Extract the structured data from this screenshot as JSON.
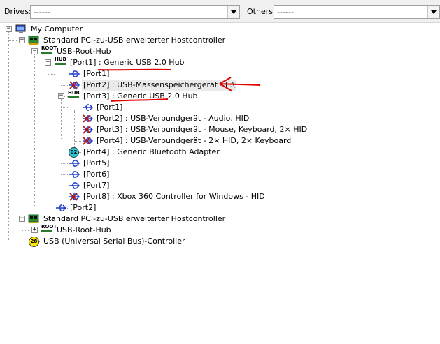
{
  "toolbar": {
    "drives_label": "Drives:",
    "drives_value": "------",
    "others_label": "Others:",
    "others_value": "------"
  },
  "tree": {
    "root": "My Computer",
    "controller1": "Standard PCI-zu-USB erweiterter Hostcontroller",
    "roothub1": "USB-Root-Hub",
    "port1": "[Port1] : Generic USB 2.0 Hub",
    "p1_port1": "[Port1]",
    "p1_port2": "[Port2] : USB-Massenspeichergerät - L:\\",
    "p1_port3": "[Port3] : Generic USB 2.0 Hub",
    "p3_port1": "[Port1]",
    "p3_port2": "[Port2] : USB-Verbundgerät - Audio, HID",
    "p3_port3": "[Port3] : USB-Verbundgerät - Mouse, Keyboard, 2× HID",
    "p3_port4": "[Port4] : USB-Verbundgerät - 2× HID, 2× Keyboard",
    "p1_port4": "[Port4] : Generic Bluetooth Adapter",
    "p1_port5": "[Port5]",
    "p1_port6": "[Port6]",
    "p1_port7": "[Port7]",
    "p1_port8": "[Port8] : Xbox 360 Controller for Windows - HID",
    "rh1_port2": "[Port2]",
    "controller2": "Standard PCI-zu-USB erweiterter Hostcontroller",
    "roothub2": "USB-Root-Hub",
    "usb_controller": "USB (Universal Serial Bus)-Controller"
  },
  "icons": {
    "root_hub_text": "ROOT",
    "hub_text": "HUB",
    "bluetooth_number": "02",
    "usb_controller_number": "28"
  },
  "colors": {
    "annotation_red": "#e00000",
    "usb_blue": "#1e3ccf",
    "device_red": "#b01818"
  }
}
